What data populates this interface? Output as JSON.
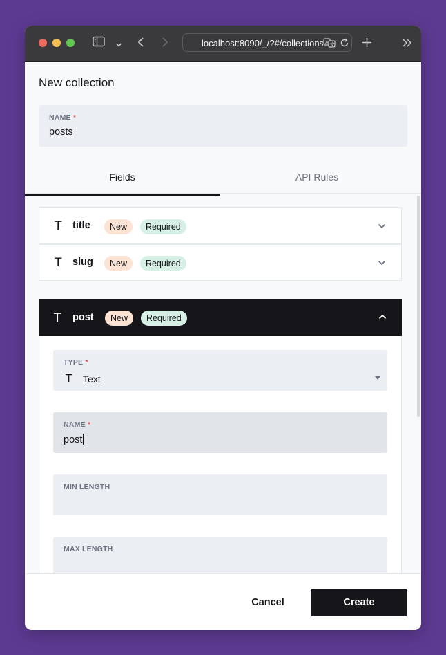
{
  "browser": {
    "url": "localhost:8090/_/?#/collections",
    "traffic_lights": {
      "close": "#ec6a5e",
      "minimize": "#f4bf4f",
      "maximize": "#61c554"
    },
    "icons": {
      "sidebar": "sidebar-toggle-icon",
      "chevron_down": "chevron-down-icon",
      "back": "back-arrow-icon",
      "forward": "forward-arrow-icon",
      "translate": "translate-icon",
      "reload": "reload-icon",
      "new_tab": "plus-icon",
      "overflow": "double-chevron-right-icon"
    }
  },
  "panel": {
    "title": "New collection",
    "name_field": {
      "label": "NAME",
      "required_mark": "*",
      "value": "posts"
    }
  },
  "tabs": [
    {
      "label": "Fields",
      "active": true
    },
    {
      "label": "API Rules",
      "active": false
    }
  ],
  "fields": [
    {
      "icon": "T",
      "name": "title",
      "badges": [
        "New",
        "Required"
      ],
      "expanded": false
    },
    {
      "icon": "T",
      "name": "slug",
      "badges": [
        "New",
        "Required"
      ],
      "expanded": false
    },
    {
      "icon": "T",
      "name": "post",
      "badges": [
        "New",
        "Required"
      ],
      "expanded": true
    }
  ],
  "expanded_field": {
    "type": {
      "label": "TYPE",
      "required_mark": "*",
      "icon": "T",
      "value": "Text"
    },
    "name": {
      "label": "NAME",
      "required_mark": "*",
      "value": "post"
    },
    "min_length": {
      "label": "MIN LENGTH",
      "value": ""
    },
    "max_length": {
      "label": "MAX LENGTH",
      "value": ""
    }
  },
  "footer": {
    "cancel_label": "Cancel",
    "create_label": "Create"
  },
  "colors": {
    "background": "#5d3a92",
    "accent_dark": "#16161a",
    "badge_new": "#fde3d4",
    "badge_required": "#d6f0e6",
    "required_mark": "#e34c4c"
  }
}
